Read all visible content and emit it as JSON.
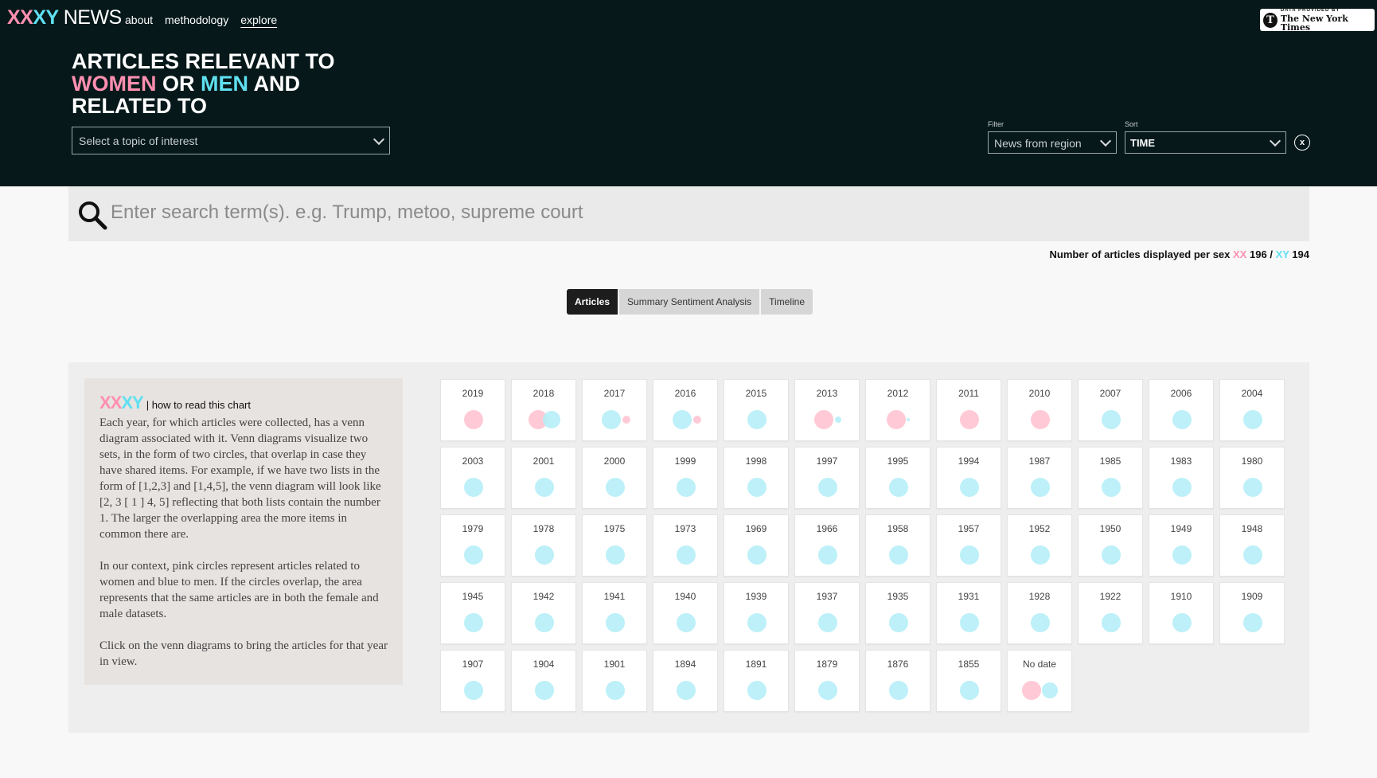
{
  "brand": {
    "xx": "XX",
    "xy": "XY",
    "news": "NEWS"
  },
  "nav": [
    {
      "label": "about",
      "active": false
    },
    {
      "label": "methodology",
      "active": false
    },
    {
      "label": "explore",
      "active": true
    }
  ],
  "credit": {
    "small": "DATA PROVIDED BY",
    "name": "The New York Times",
    "mark": "T"
  },
  "headline": {
    "line1": "ARTICLES RELEVANT TO",
    "women": "WOMEN",
    "or": "OR",
    "men": "MEN",
    "and": "AND",
    "line3": "RELATED TO"
  },
  "topic_select": {
    "placeholder": "Select a topic of interest"
  },
  "filter": {
    "label": "Filter",
    "value": "News from region"
  },
  "sort": {
    "label": "Sort",
    "value": "TIME"
  },
  "clear_label": "x",
  "search": {
    "placeholder": "Enter search term(s). e.g. Trump, metoo, supreme court"
  },
  "counts": {
    "prefix": "Number of articles displayed per sex",
    "xx_label": "XX",
    "xx_count": "196",
    "sep": "/",
    "xy_label": "XY",
    "xy_count": "194"
  },
  "tabs": [
    {
      "label": "Articles",
      "active": true
    },
    {
      "label": "Summary Sentiment Analysis",
      "active": false
    },
    {
      "label": "Timeline",
      "active": false
    }
  ],
  "howto": {
    "xx": "XX",
    "xy": "XY",
    "subtitle": "| how to read this chart",
    "p1": "Each year, for which articles were collected, has a venn diagram associated with it. Venn diagrams visualize two sets, in the form of two circles, that overlap in case they have shared items. For example, if we have two lists in the form of [1,2,3] and [1,4,5], the venn diagram will look like [2, 3 [ 1 ] 4, 5] reflecting that both lists contain the number 1. The larger the overlapping area the more items in common there are.",
    "p2": "In our context, pink circles represent articles related to women and blue to men. If the circles overlap, the area represents that the same articles are in both the female and male datasets.",
    "p3": "Click on the venn diagrams to bring the articles for that year in view."
  },
  "colors": {
    "pink": "#ffc4d2",
    "blue": "#b6eef7"
  },
  "years": [
    {
      "label": "2019",
      "venn": "pink"
    },
    {
      "label": "2018",
      "venn": "both-overlap"
    },
    {
      "label": "2017",
      "venn": "blue-bigger"
    },
    {
      "label": "2016",
      "venn": "blue-bigger"
    },
    {
      "label": "2015",
      "venn": "blue"
    },
    {
      "label": "2013",
      "venn": "pink-bigger"
    },
    {
      "label": "2012",
      "venn": "pink-tiny-blue"
    },
    {
      "label": "2011",
      "venn": "pink"
    },
    {
      "label": "2010",
      "venn": "pink"
    },
    {
      "label": "2007",
      "venn": "blue"
    },
    {
      "label": "2006",
      "venn": "blue"
    },
    {
      "label": "2004",
      "venn": "blue"
    },
    {
      "label": "2003",
      "venn": "blue"
    },
    {
      "label": "2001",
      "venn": "blue"
    },
    {
      "label": "2000",
      "venn": "blue"
    },
    {
      "label": "1999",
      "venn": "blue"
    },
    {
      "label": "1998",
      "venn": "blue"
    },
    {
      "label": "1997",
      "venn": "blue"
    },
    {
      "label": "1995",
      "venn": "blue"
    },
    {
      "label": "1994",
      "venn": "blue"
    },
    {
      "label": "1987",
      "venn": "blue"
    },
    {
      "label": "1985",
      "venn": "blue"
    },
    {
      "label": "1983",
      "venn": "blue"
    },
    {
      "label": "1980",
      "venn": "blue"
    },
    {
      "label": "1979",
      "venn": "blue"
    },
    {
      "label": "1978",
      "venn": "blue"
    },
    {
      "label": "1975",
      "venn": "blue"
    },
    {
      "label": "1973",
      "venn": "blue"
    },
    {
      "label": "1969",
      "venn": "blue"
    },
    {
      "label": "1966",
      "venn": "blue"
    },
    {
      "label": "1958",
      "venn": "blue"
    },
    {
      "label": "1957",
      "venn": "blue"
    },
    {
      "label": "1952",
      "venn": "blue"
    },
    {
      "label": "1950",
      "venn": "blue"
    },
    {
      "label": "1949",
      "venn": "blue"
    },
    {
      "label": "1948",
      "venn": "blue"
    },
    {
      "label": "1945",
      "venn": "blue"
    },
    {
      "label": "1942",
      "venn": "blue"
    },
    {
      "label": "1941",
      "venn": "blue"
    },
    {
      "label": "1940",
      "venn": "blue"
    },
    {
      "label": "1939",
      "venn": "blue"
    },
    {
      "label": "1937",
      "venn": "blue"
    },
    {
      "label": "1935",
      "venn": "blue"
    },
    {
      "label": "1931",
      "venn": "blue"
    },
    {
      "label": "1928",
      "venn": "blue"
    },
    {
      "label": "1922",
      "venn": "blue"
    },
    {
      "label": "1910",
      "venn": "blue"
    },
    {
      "label": "1909",
      "venn": "blue"
    },
    {
      "label": "1907",
      "venn": "blue"
    },
    {
      "label": "1904",
      "venn": "blue"
    },
    {
      "label": "1901",
      "venn": "blue"
    },
    {
      "label": "1894",
      "venn": "blue"
    },
    {
      "label": "1891",
      "venn": "blue"
    },
    {
      "label": "1879",
      "venn": "blue"
    },
    {
      "label": "1876",
      "venn": "blue"
    },
    {
      "label": "1855",
      "venn": "blue"
    },
    {
      "label": "No date",
      "venn": "both-separate"
    }
  ]
}
